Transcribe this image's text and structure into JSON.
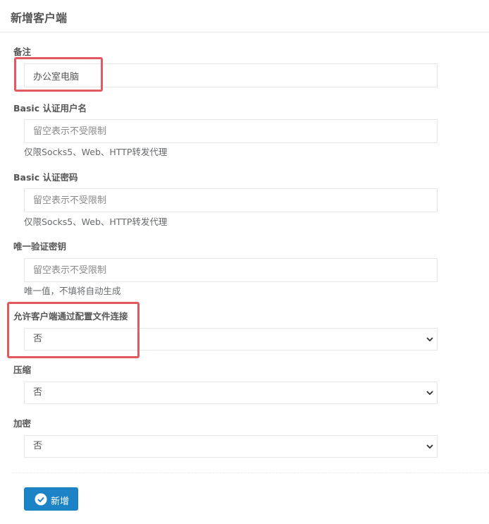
{
  "header": {
    "title": "新增客户端"
  },
  "form": {
    "remark": {
      "label": "备注",
      "value": "办公室电脑"
    },
    "basic_user": {
      "label": "Basic 认证用户名",
      "placeholder": "留空表示不受限制",
      "help": "仅限Socks5、Web、HTTP转发代理"
    },
    "basic_pass": {
      "label": "Basic 认证密码",
      "placeholder": "留空表示不受限制",
      "help": "仅限Socks5、Web、HTTP转发代理"
    },
    "vkey": {
      "label": "唯一验证密钥",
      "placeholder": "留空表示不受限制",
      "help": "唯一值，不填将自动生成"
    },
    "config_conn": {
      "label": "允许客户端通过配置文件连接",
      "value": "否"
    },
    "compress": {
      "label": "压缩",
      "value": "否"
    },
    "crypt": {
      "label": "加密",
      "value": "否"
    }
  },
  "actions": {
    "submit_label": "新增"
  },
  "colors": {
    "accent": "#1c84c6",
    "highlight": "#e05a5f"
  },
  "icons": {
    "submit": "check-circle-icon",
    "select": "chevron-down-icon"
  }
}
